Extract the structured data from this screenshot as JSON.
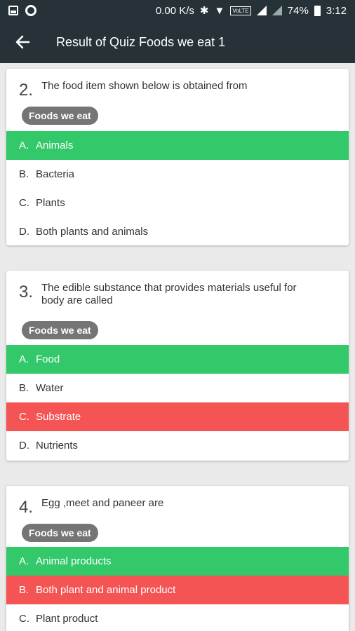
{
  "status": {
    "speed": "0.00 K/s",
    "volte": "VoLTE",
    "battery": "74%",
    "time": "3:12"
  },
  "appbar": {
    "title": "Result of Quiz Foods we eat 1"
  },
  "questions": [
    {
      "num": "2.",
      "text": "The food item shown below is obtained from",
      "tag": "Foods we eat",
      "options": [
        {
          "letter": "A.",
          "text": "Animals"
        },
        {
          "letter": "B.",
          "text": "Bacteria"
        },
        {
          "letter": "C.",
          "text": "Plants"
        },
        {
          "letter": "D.",
          "text": "Both plants and animals"
        }
      ]
    },
    {
      "num": "3.",
      "text": "The edible substance that provides materials useful for body are called",
      "tag": "Foods we eat",
      "options": [
        {
          "letter": "A.",
          "text": "Food"
        },
        {
          "letter": "B.",
          "text": "Water"
        },
        {
          "letter": "C.",
          "text": "Substrate"
        },
        {
          "letter": "D.",
          "text": "Nutrients"
        }
      ]
    },
    {
      "num": "4.",
      "text": "Egg ,meet and paneer are",
      "tag": "Foods we eat",
      "options": [
        {
          "letter": "A.",
          "text": "Animal products"
        },
        {
          "letter": "B.",
          "text": "Both plant and animal product"
        },
        {
          "letter": "C.",
          "text": "Plant product"
        }
      ]
    }
  ],
  "colors": {
    "correct": "#33c86a",
    "wrong": "#f45454",
    "appbar": "#263238"
  }
}
